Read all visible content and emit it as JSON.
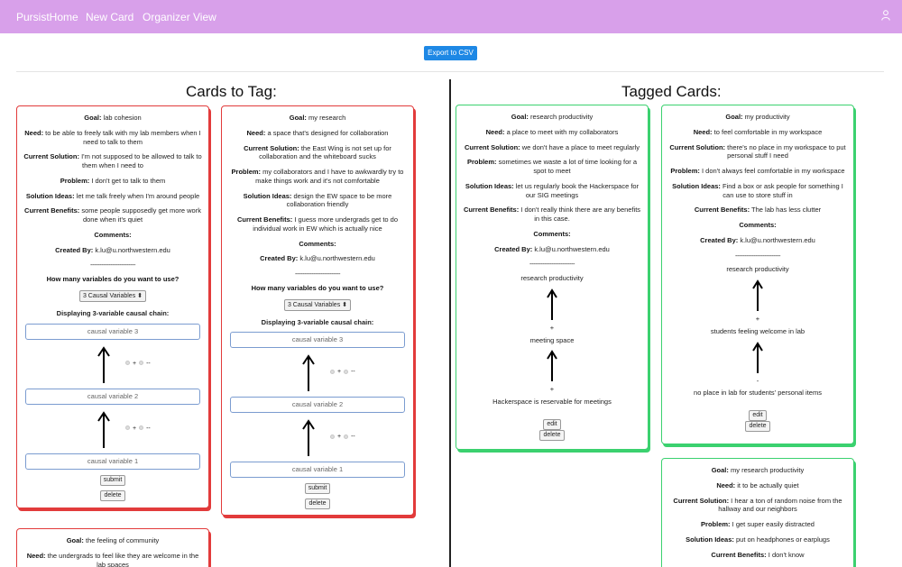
{
  "nav": {
    "brand": "PursistHome",
    "new_card": "New Card",
    "organizer": "Organizer View",
    "user_icon": "user-icon"
  },
  "toolbar": {
    "export": "Export to CSV"
  },
  "headings": {
    "left": "Cards to Tag:",
    "right": "Tagged Cards:"
  },
  "labels": {
    "goal": "Goal:",
    "need": "Need:",
    "current_solution": "Current Solution:",
    "problem": "Problem:",
    "solution_ideas": "Solution Ideas:",
    "current_benefits": "Current Benefits:",
    "comments": "Comments:",
    "created_by": "Created By:",
    "separator": "-------------------------",
    "how_many": "How many variables do you want to use?",
    "displaying": "Displaying 3-variable causal chain:",
    "select_value": "3 Causal Variables",
    "cv3": "causal variable 3",
    "cv2": "causal variable 2",
    "cv1": "causal variable 1",
    "plus": "+",
    "minus": "--",
    "submit": "submit",
    "delete": "delete",
    "edit": "edit"
  },
  "cards_to_tag": [
    {
      "goal": "lab cohesion",
      "need": "to be able to freely talk with my lab members when I need to talk to them",
      "current_solution": "I'm not supposed to be allowed to talk to them when I need to",
      "problem": "I don't get to talk to them",
      "solution_ideas": "let me talk freely when I'm around people",
      "current_benefits": "some people supposedly get more work done when it's quiet",
      "created_by": "k.lu@u.northwestern.edu"
    },
    {
      "goal": "my research",
      "need": "a space that's designed for collaboration",
      "current_solution": "the East Wing is not set up for collaboration and the whiteboard sucks",
      "problem": "my collaborators and I have to awkwardly try to make things work and it's not comfortable",
      "solution_ideas": "design the EW space to be more collaboration friendly",
      "current_benefits": "I guess more undergrads get to do individual work in EW which is actually nice",
      "created_by": "k.lu@u.northwestern.edu"
    },
    {
      "goal": "the feeling of community",
      "need": "the undergrads to feel like they are welcome in the lab spaces"
    }
  ],
  "tagged_cards": [
    {
      "goal": "research productivity",
      "need": "a place to meet with my collaborators",
      "current_solution": "we don't have a place to meet regularly",
      "problem": "sometimes we waste a lot of time looking for a spot to meet",
      "solution_ideas": "let us regularly book the Hackerspace for our SIG meetings",
      "current_benefits": "I don't really think there are any benefits in this case.",
      "created_by": "k.lu@u.northwestern.edu",
      "chain": [
        "research productivity",
        "meeting space",
        "Hackerspace is reservable for meetings"
      ],
      "signs": [
        "+",
        "+"
      ]
    },
    {
      "goal": "my productivity",
      "need": "to feel comfortable in my workspace",
      "current_solution": "there's no place in my workspace to put personal stuff I need",
      "problem": "I don't always feel comfortable in my workspace",
      "solution_ideas": "Find a box or ask people for something I can use to store stuff in",
      "current_benefits": "The lab has less clutter",
      "created_by": "k.lu@u.northwestern.edu",
      "chain": [
        "research productivity",
        "students feeling welcome in lab",
        "no place in lab for students' personal items"
      ],
      "signs": [
        "+",
        "-"
      ]
    },
    {
      "goal": "my research productivity",
      "need": "it to be actually quiet",
      "current_solution": "I hear a ton of random noise from the hallway and our neighbors",
      "problem": "I get super easily distracted",
      "solution_ideas": "put on headphones or earplugs",
      "current_benefits": "I don't know"
    }
  ],
  "colors": {
    "navbar": "#d8a0ea",
    "export": "#1e88e5",
    "untagged_border": "#e23b3b",
    "tagged_border": "#3bd16f"
  }
}
